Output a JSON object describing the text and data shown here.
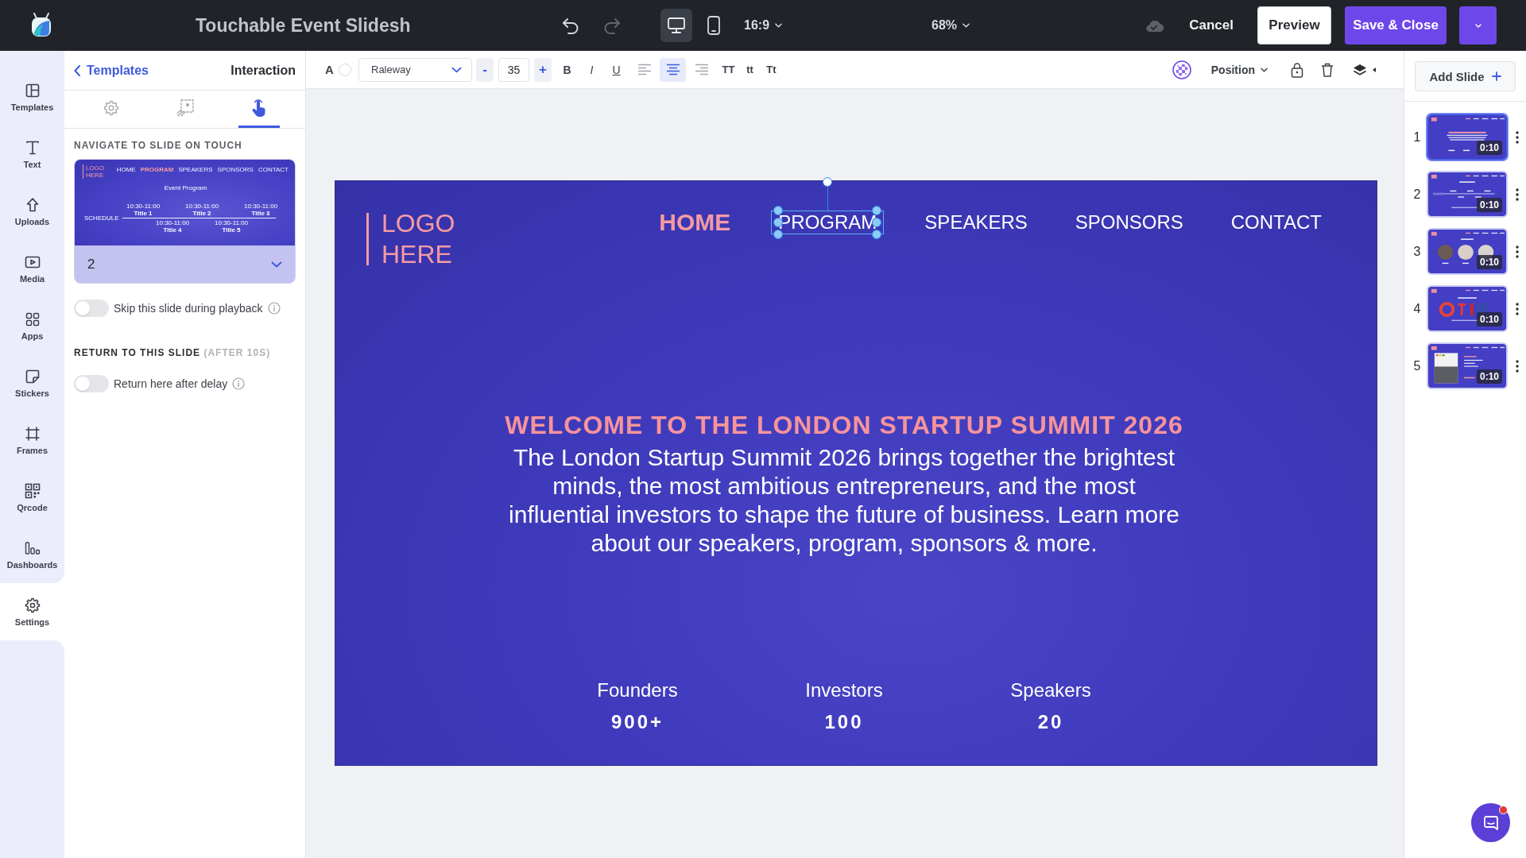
{
  "top_bar": {
    "title": "Touchable Event Slidesh",
    "history": [
      {
        "kind": "undo",
        "disabled": false
      },
      {
        "kind": "redo",
        "disabled": true
      }
    ],
    "devices": [
      {
        "kind": "desktop",
        "selected": true
      },
      {
        "kind": "mobile",
        "selected": false
      }
    ],
    "aspect_ratio": "16:9",
    "zoom": "68%",
    "cloud_saved": true,
    "actions": [
      {
        "kind": "cancel",
        "label": "Cancel"
      },
      {
        "kind": "preview",
        "label": "Preview"
      },
      {
        "kind": "save",
        "label": "Save & Close"
      },
      {
        "kind": "menu"
      }
    ]
  },
  "sidebar": {
    "items": [
      {
        "kind": "templates",
        "label": "Templates",
        "selected": false
      },
      {
        "kind": "text",
        "label": "Text",
        "selected": false
      },
      {
        "kind": "uploads",
        "label": "Uploads",
        "selected": false
      },
      {
        "kind": "media",
        "label": "Media",
        "selected": false
      },
      {
        "kind": "apps",
        "label": "Apps",
        "selected": false
      },
      {
        "kind": "stickers",
        "label": "Stickers",
        "selected": false
      },
      {
        "kind": "frames",
        "label": "Frames",
        "selected": false
      },
      {
        "kind": "qrcode",
        "label": "Qrcode",
        "selected": false
      },
      {
        "kind": "dashboards",
        "label": "Dashboards",
        "selected": false
      },
      {
        "kind": "settings",
        "label": "Settings",
        "selected": true
      }
    ]
  },
  "panel": {
    "back_link": "Templates",
    "title": "Interaction",
    "tabs": [
      {
        "kind": "settings",
        "selected": false
      },
      {
        "kind": "animation",
        "selected": false
      },
      {
        "kind": "touch",
        "selected": true
      }
    ],
    "navigate_heading": "NAVIGATE TO SLIDE ON TOUCH",
    "slide_select": {
      "value": "2",
      "preview": {
        "logo": "LOGO HERE",
        "nav": [
          {
            "label": "HOME",
            "active": false
          },
          {
            "label": "PROGRAM",
            "active": true
          },
          {
            "label": "SPEAKERS",
            "active": false
          },
          {
            "label": "SPONSORS",
            "active": false
          },
          {
            "label": "CONTACT",
            "active": false
          }
        ],
        "title": "Event Program",
        "schedule_label": "SCHEDULE",
        "schedule_top": [
          {
            "time": "10:30-11:00",
            "title": "Title 1"
          },
          {
            "time": "10:30-11:00",
            "title": "Title 2"
          },
          {
            "time": "10:30-11:00",
            "title": "Title 3"
          }
        ],
        "schedule_bottom": [
          {
            "time": "10:30-11:00",
            "title": "Title 4"
          },
          {
            "time": "10:30-11:00",
            "title": "Title 5"
          }
        ]
      }
    },
    "skip_toggle": {
      "label": "Skip this slide during playback",
      "on": false
    },
    "return_heading": "RETURN TO THIS SLIDE",
    "return_note": "(AFTER 10S)",
    "return_toggle": {
      "label": "Return here after delay",
      "on": false
    }
  },
  "toolbar": {
    "color_label": "A",
    "font": "Raleway",
    "size_minus": "-",
    "font_size": "35",
    "size_plus": "+",
    "styles": [
      {
        "kind": "bold",
        "label": "B"
      },
      {
        "kind": "italic",
        "label": "I"
      },
      {
        "kind": "underline",
        "label": "U"
      }
    ],
    "alignments": [
      {
        "kind": "left",
        "selected": false
      },
      {
        "kind": "center",
        "selected": true
      },
      {
        "kind": "right",
        "selected": false
      }
    ],
    "cases": [
      "TT",
      "tt",
      "Tt"
    ],
    "position": "Position"
  },
  "slide": {
    "logo": "LOGO HERE",
    "nav": [
      {
        "label": "HOME",
        "active": true,
        "selected": false
      },
      {
        "label": "PROGRAM",
        "active": false,
        "selected": true
      },
      {
        "label": "SPEAKERS",
        "active": false,
        "selected": false
      },
      {
        "label": "SPONSORS",
        "active": false,
        "selected": false
      },
      {
        "label": "CONTACT",
        "active": false,
        "selected": false
      }
    ],
    "heading": "WELCOME TO THE LONDON STARTUP SUMMIT 2026",
    "body": "The London Startup Summit 2026 brings together the brightest minds, the most ambitious entrepreneurs, and the most influential investors to shape the future of business. Learn more about our speakers, program, sponsors & more.",
    "stats": [
      {
        "label": "Founders",
        "value": "900+"
      },
      {
        "label": "Investors",
        "value": "100"
      },
      {
        "label": "Speakers",
        "value": "20"
      }
    ]
  },
  "slides_panel": {
    "add_button": "Add Slide",
    "slides": [
      {
        "number": "1",
        "kind": "intro",
        "duration": "0:10",
        "selected": true
      },
      {
        "number": "2",
        "kind": "schedule",
        "duration": "0:10",
        "selected": false
      },
      {
        "number": "3",
        "kind": "speakers",
        "duration": "0:10",
        "selected": false
      },
      {
        "number": "4",
        "kind": "sponsors",
        "duration": "0:10",
        "selected": false
      },
      {
        "number": "5",
        "kind": "gallery",
        "duration": "0:10",
        "selected": false
      }
    ]
  },
  "chat": {
    "unread": true
  }
}
